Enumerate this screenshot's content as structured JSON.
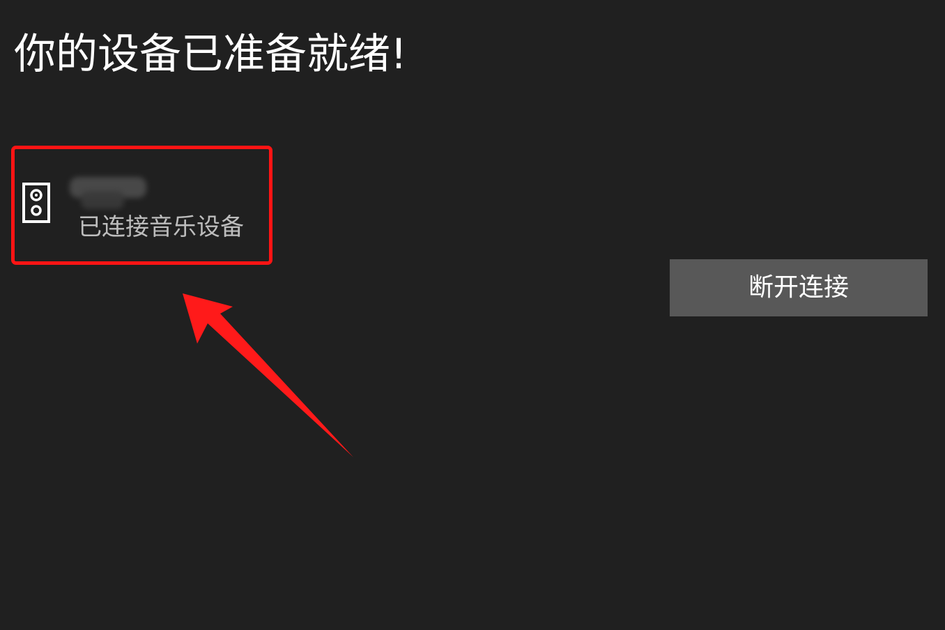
{
  "header": {
    "title": "你的设备已准备就绪!"
  },
  "device": {
    "icon": "speaker-icon",
    "status": "已连接音乐设备"
  },
  "actions": {
    "disconnect_label": "断开连接"
  },
  "annotation": {
    "icon": "arrow-icon",
    "highlight_color": "#ff1414"
  }
}
